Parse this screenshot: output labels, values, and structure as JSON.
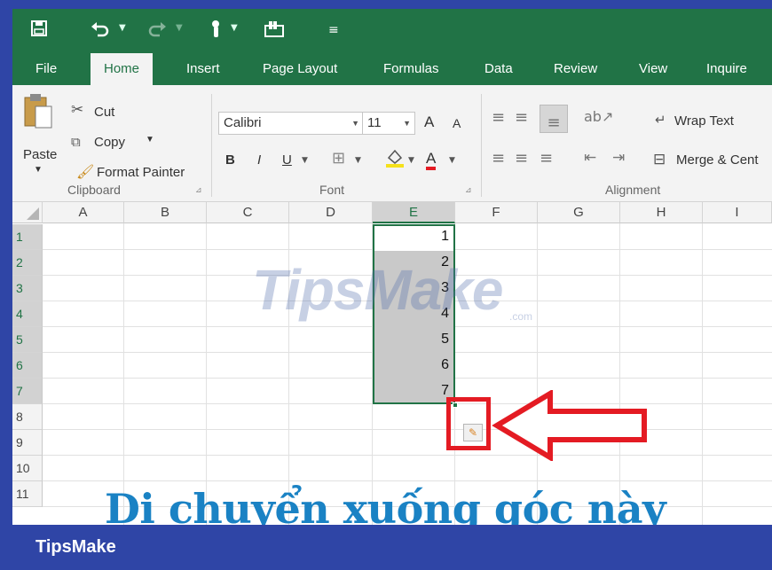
{
  "qat": {
    "save_icon": "save-icon",
    "undo_icon": "undo-icon",
    "redo_icon": "redo-icon",
    "touch_icon": "touch-mode-icon",
    "camera_icon": "camera-icon",
    "customize_icon": "customize-icon"
  },
  "tabs": [
    "File",
    "Home",
    "Insert",
    "Page Layout",
    "Formulas",
    "Data",
    "Review",
    "View",
    "Inquire"
  ],
  "ribbon": {
    "clipboard": {
      "paste": "Paste",
      "cut": "Cut",
      "copy": "Copy",
      "format_painter": "Format Painter",
      "label": "Clipboard"
    },
    "font": {
      "name": "Calibri",
      "size": "11",
      "bold": "B",
      "italic": "I",
      "underline": "U",
      "grow": "A",
      "shrink": "A",
      "font_color": "A",
      "label": "Font"
    },
    "alignment": {
      "wrap_text": "Wrap Text",
      "merge": "Merge & Cent",
      "label": "Alignment"
    }
  },
  "grid": {
    "columns": [
      "A",
      "B",
      "C",
      "D",
      "E",
      "F",
      "G",
      "H",
      "I"
    ],
    "rows": [
      "1",
      "2",
      "3",
      "4",
      "5",
      "6",
      "7",
      "8",
      "9",
      "10",
      "11"
    ],
    "e_values": [
      "1",
      "2",
      "3",
      "4",
      "5",
      "6",
      "7"
    ]
  },
  "watermark": "TipsMake",
  "watermark_suffix": ".com",
  "caption": "Di chuyển xuống góc này",
  "footer_brand": "TipsMake",
  "colors": {
    "excel_green": "#217346",
    "frame_blue": "#2f45a6",
    "highlight_red": "#e41b23",
    "caption_blue": "#1a82c4"
  }
}
